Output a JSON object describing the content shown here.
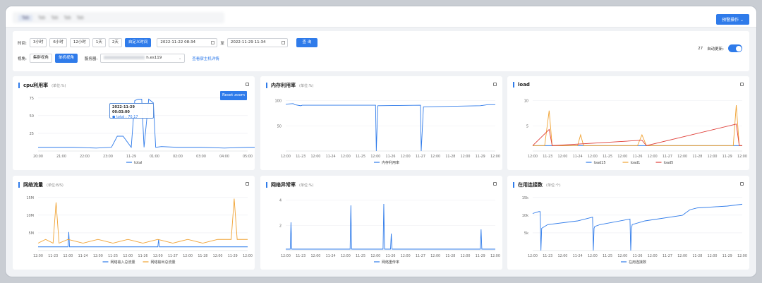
{
  "header": {
    "tabs": [
      "Tab",
      "Tab",
      "Tab",
      "Tab",
      "Tab",
      "Tab",
      "Tab"
    ],
    "alarm_btn": "预警操作 ⌄"
  },
  "filter": {
    "time_label": "时间:",
    "time_buttons": [
      "3小时",
      "6小时",
      "12小时",
      "1天",
      "2天",
      "自定义时间"
    ],
    "start": "2022-11-22 08:34",
    "to": "至",
    "end": "2022-11-29 11:34",
    "search": "查 询",
    "view_label": "视角:",
    "views": [
      "集群视角",
      "单机视角"
    ],
    "server_label": "服务器:",
    "server_suffix": "h.es119",
    "host_link": "查看宿主机详情",
    "countdown": "27",
    "auto_label": "自动更新:"
  },
  "panels": {
    "cpu": {
      "title": "cpu利用率",
      "unit": "(单位:%)",
      "reset": "Reset zoom",
      "tip_date": "2022-11-29 00:03:00",
      "tip_value": "● total : 70.17"
    },
    "mem": {
      "title": "内存利用率",
      "unit": "(单位:%)"
    },
    "load": {
      "title": "load",
      "unit": ""
    },
    "net": {
      "title": "网络流量",
      "unit": "(单位:B/S)"
    },
    "neterr": {
      "title": "网络异常率",
      "unit": "(单位:%)"
    },
    "conn": {
      "title": "在用连接数",
      "unit": "(单位:个)"
    }
  },
  "colors": {
    "primary": "#2f7bea",
    "orange": "#f0a232",
    "red": "#e0403a"
  },
  "chart_data": [
    {
      "type": "line",
      "title": "cpu利用率",
      "ylabel": "(单位:%)",
      "y_ticks": [
        "75",
        "50",
        "25"
      ],
      "ylim": [
        0,
        80
      ],
      "x_ticks": [
        "20:00",
        "21:00",
        "22:00",
        "23:00",
        "11-29",
        "01:00",
        "02:00",
        "03:00",
        "04:00",
        "05:00"
      ],
      "series": [
        {
          "name": "total",
          "x": [
            0,
            1.5,
            2.5,
            3.15,
            3.4,
            3.65,
            4.0,
            4.15,
            4.3,
            4.45,
            4.55,
            4.75,
            4.95,
            5.05,
            5.3,
            6.0,
            7.0,
            8.0,
            9.0,
            9.4
          ],
          "values": [
            5,
            5,
            4,
            5,
            20,
            20,
            5,
            68,
            70,
            70,
            5,
            70,
            65,
            5,
            6,
            5,
            5,
            4,
            5,
            5
          ]
        }
      ]
    },
    {
      "type": "line",
      "title": "内存利用率",
      "ylabel": "(单位:%)",
      "y_ticks": [
        "100",
        "50"
      ],
      "ylim": [
        0,
        110
      ],
      "x_ticks": [
        "12:00",
        "11-23",
        "12:00",
        "11-24",
        "12:00",
        "11-25",
        "12:00",
        "11-26",
        "12:00",
        "11-27",
        "12:00",
        "11-28",
        "12:00",
        "11-29",
        "12:00"
      ],
      "series": [
        {
          "name": "内存利用率",
          "x": [
            0,
            0.5,
            0.6,
            1.0,
            1.1,
            6.0,
            6.05,
            6.15,
            9.0,
            9.05,
            9.2,
            13.0,
            13.5,
            14.0
          ],
          "values": [
            87,
            88,
            86,
            84,
            85,
            85,
            0,
            84,
            85,
            0,
            82,
            84,
            86,
            86
          ]
        }
      ]
    },
    {
      "type": "line",
      "title": "load",
      "y_ticks": [
        "10",
        "5"
      ],
      "ylim": [
        0,
        11
      ],
      "x_ticks": [
        "12:00",
        "11-23",
        "12:00",
        "11-24",
        "12:00",
        "11-25",
        "12:00",
        "11-26",
        "12:00",
        "11-27",
        "12:00",
        "11-28",
        "12:00",
        "11-29",
        "12:00"
      ],
      "series": [
        {
          "name": "load15",
          "x": [
            0,
            1,
            2,
            3,
            4,
            5,
            6,
            7,
            8,
            9,
            10,
            11,
            12,
            13,
            14
          ],
          "values": [
            1,
            1,
            1,
            1,
            1,
            1,
            1,
            1,
            1,
            1,
            1,
            1,
            1,
            1,
            1
          ]
        },
        {
          "name": "load1",
          "x": [
            0,
            0.8,
            1.1,
            1.3,
            3.0,
            3.2,
            3.4,
            6.0,
            7.0,
            7.3,
            7.6,
            10.0,
            11.0,
            13.4,
            13.6,
            13.8,
            14.0
          ],
          "values": [
            1,
            1,
            7.5,
            1,
            1,
            3,
            1,
            1,
            1,
            3,
            1,
            1,
            1,
            1,
            8.5,
            1,
            1
          ]
        },
        {
          "name": "load5",
          "x": [
            0,
            1.1,
            1.3,
            7.3,
            7.6,
            13.6,
            13.8,
            14.0
          ],
          "values": [
            1,
            4,
            1,
            2,
            1,
            5,
            1,
            1
          ]
        }
      ]
    },
    {
      "type": "line",
      "title": "网络流量",
      "ylabel": "(单位:B/S)",
      "y_ticks": [
        "15M",
        "10M",
        "5M"
      ],
      "ylim": [
        0,
        16
      ],
      "x_ticks": [
        "12:00",
        "11-23",
        "12:00",
        "11-24",
        "12:00",
        "11-25",
        "12:00",
        "11-26",
        "12:00",
        "11-27",
        "12:00",
        "11-28",
        "12:00",
        "11-29",
        "12:00"
      ],
      "series": [
        {
          "name": "网络输入总流量",
          "x": [
            0,
            2.0,
            2.05,
            2.1,
            8.0,
            8.05,
            8.1,
            14.0
          ],
          "values": [
            1,
            1,
            5,
            1,
            1,
            3,
            1,
            1
          ]
        },
        {
          "name": "网络输出总流量",
          "x": [
            0,
            0.5,
            1.0,
            1.2,
            1.4,
            2.0,
            3.0,
            4.0,
            5.0,
            6.0,
            7.0,
            8.0,
            9.0,
            10.0,
            11.0,
            12.0,
            12.9,
            13.1,
            13.3,
            14.0
          ],
          "values": [
            2,
            3,
            2,
            13,
            2,
            3,
            2,
            3,
            2,
            3,
            2,
            3,
            2,
            3,
            2,
            3,
            3,
            14,
            3,
            3
          ]
        }
      ]
    },
    {
      "type": "line",
      "title": "网络异常率",
      "ylabel": "(单位:%)",
      "y_ticks": [
        "4",
        "2"
      ],
      "ylim": [
        0,
        4.2
      ],
      "x_ticks": [
        "12:00",
        "11-23",
        "12:00",
        "11-24",
        "12:00",
        "11-25",
        "12:00",
        "11-26",
        "12:00",
        "11-27",
        "12:00",
        "11-28",
        "12:00",
        "11-29",
        "12:00"
      ],
      "series": [
        {
          "name": "网络重传率",
          "x": [
            0,
            0.3,
            0.35,
            0.4,
            4.3,
            4.35,
            4.4,
            6.5,
            6.55,
            6.6,
            7.0,
            7.05,
            7.1,
            13.0,
            13.05,
            13.1,
            14.0
          ],
          "values": [
            0.1,
            0.1,
            2,
            0.1,
            0.1,
            3.2,
            0.1,
            0.1,
            3.3,
            0.1,
            0.1,
            1.2,
            0.1,
            0.1,
            1.5,
            0.1,
            0.1
          ]
        }
      ]
    },
    {
      "type": "line",
      "title": "在用连接数",
      "ylabel": "(单位:个)",
      "y_ticks": [
        "15k",
        "10k",
        "5k"
      ],
      "ylim": [
        0,
        16
      ],
      "x_ticks": [
        "12:00",
        "11-23",
        "12:00",
        "11-24",
        "12:00",
        "11-25",
        "12:00",
        "11-26",
        "12:00",
        "11-27",
        "12:00",
        "11-28",
        "12:00",
        "11-29",
        "12:00"
      ],
      "series": [
        {
          "name": "在用连接数",
          "x": [
            0,
            0.4,
            0.5,
            0.55,
            0.6,
            1.0,
            3.0,
            4.0,
            4.05,
            4.1,
            4.15,
            4.5,
            6.5,
            6.55,
            6.6,
            6.65,
            7.5,
            10.0,
            10.5,
            11.0,
            13.0,
            14.0
          ],
          "values": [
            10,
            10.5,
            10.5,
            0,
            6,
            7,
            8,
            9,
            0,
            6,
            6.5,
            7,
            8.5,
            0,
            6,
            7,
            8,
            9.5,
            11,
            11.5,
            12,
            12.5
          ]
        }
      ]
    }
  ]
}
